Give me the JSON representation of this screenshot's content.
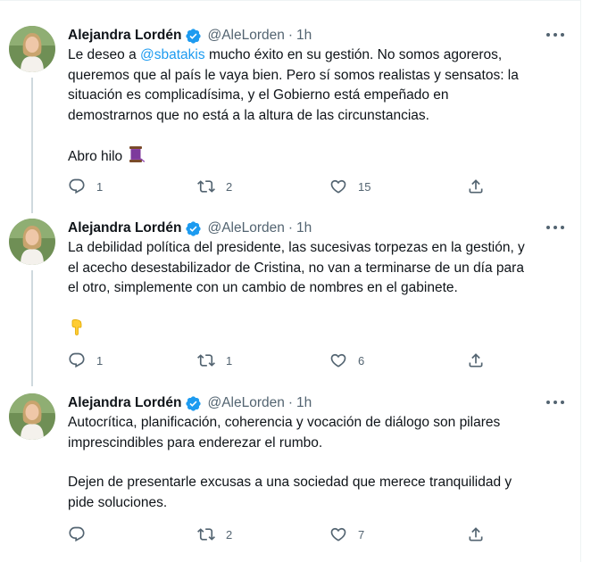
{
  "author": {
    "name": "Alejandra Lordén",
    "handle": "@AleLorden",
    "separator": "·"
  },
  "colors": {
    "text": "#0f1419",
    "secondary": "#536471",
    "link": "#1d9bf0",
    "thread_line": "#cfd9de"
  },
  "tweets": [
    {
      "time": "1h",
      "lines": [
        "mucho éxito en su gestión. No somos agoreros,",
        "queremos que al país le vaya bien. Pero sí somos realistas y sensatos: la",
        "situación es complicadísima, y el Gobierno está empeñado en",
        "demostrarnos que no está a la altura de las circunstancias."
      ],
      "prefix": "Le deseo a ",
      "mention": "@sbatakis",
      "closing": "Abro hilo",
      "closing_emoji": "thread-spool-icon",
      "replies": "1",
      "retweets": "2",
      "likes": "15"
    },
    {
      "time": "1h",
      "lines": [
        "La debilidad política del presidente, las sucesivas torpezas en la gestión, y",
        "el acecho desestabilizador de Cristina, no van a terminarse de un día para",
        "el otro, simplemente con un cambio de nombres en el gabinete."
      ],
      "closing_emoji": "pointing-down-hand-icon",
      "replies": "1",
      "retweets": "1",
      "likes": "6"
    },
    {
      "time": "1h",
      "lines": [
        "Autocrítica, planificación, coherencia y vocación de diálogo son pilares",
        "imprescindibles para enderezar el rumbo."
      ],
      "lines2": [
        "Dejen de presentarle excusas a una sociedad que merece tranquilidad y",
        "pide soluciones."
      ],
      "replies": "",
      "retweets": "2",
      "likes": "7"
    }
  ]
}
